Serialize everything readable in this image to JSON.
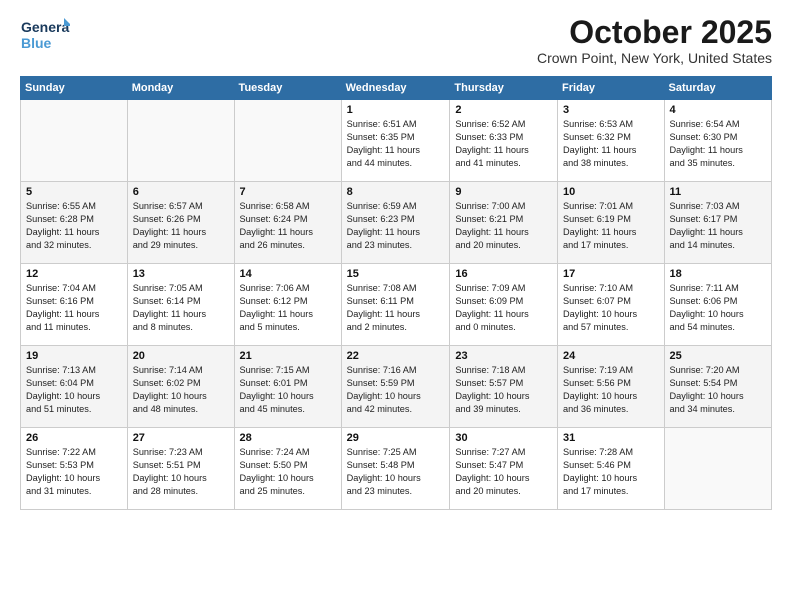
{
  "header": {
    "logo_line1": "General",
    "logo_line2": "Blue",
    "month_title": "October 2025",
    "location": "Crown Point, New York, United States"
  },
  "weekdays": [
    "Sunday",
    "Monday",
    "Tuesday",
    "Wednesday",
    "Thursday",
    "Friday",
    "Saturday"
  ],
  "weeks": [
    [
      {
        "day": "",
        "info": ""
      },
      {
        "day": "",
        "info": ""
      },
      {
        "day": "",
        "info": ""
      },
      {
        "day": "1",
        "info": "Sunrise: 6:51 AM\nSunset: 6:35 PM\nDaylight: 11 hours\nand 44 minutes."
      },
      {
        "day": "2",
        "info": "Sunrise: 6:52 AM\nSunset: 6:33 PM\nDaylight: 11 hours\nand 41 minutes."
      },
      {
        "day": "3",
        "info": "Sunrise: 6:53 AM\nSunset: 6:32 PM\nDaylight: 11 hours\nand 38 minutes."
      },
      {
        "day": "4",
        "info": "Sunrise: 6:54 AM\nSunset: 6:30 PM\nDaylight: 11 hours\nand 35 minutes."
      }
    ],
    [
      {
        "day": "5",
        "info": "Sunrise: 6:55 AM\nSunset: 6:28 PM\nDaylight: 11 hours\nand 32 minutes."
      },
      {
        "day": "6",
        "info": "Sunrise: 6:57 AM\nSunset: 6:26 PM\nDaylight: 11 hours\nand 29 minutes."
      },
      {
        "day": "7",
        "info": "Sunrise: 6:58 AM\nSunset: 6:24 PM\nDaylight: 11 hours\nand 26 minutes."
      },
      {
        "day": "8",
        "info": "Sunrise: 6:59 AM\nSunset: 6:23 PM\nDaylight: 11 hours\nand 23 minutes."
      },
      {
        "day": "9",
        "info": "Sunrise: 7:00 AM\nSunset: 6:21 PM\nDaylight: 11 hours\nand 20 minutes."
      },
      {
        "day": "10",
        "info": "Sunrise: 7:01 AM\nSunset: 6:19 PM\nDaylight: 11 hours\nand 17 minutes."
      },
      {
        "day": "11",
        "info": "Sunrise: 7:03 AM\nSunset: 6:17 PM\nDaylight: 11 hours\nand 14 minutes."
      }
    ],
    [
      {
        "day": "12",
        "info": "Sunrise: 7:04 AM\nSunset: 6:16 PM\nDaylight: 11 hours\nand 11 minutes."
      },
      {
        "day": "13",
        "info": "Sunrise: 7:05 AM\nSunset: 6:14 PM\nDaylight: 11 hours\nand 8 minutes."
      },
      {
        "day": "14",
        "info": "Sunrise: 7:06 AM\nSunset: 6:12 PM\nDaylight: 11 hours\nand 5 minutes."
      },
      {
        "day": "15",
        "info": "Sunrise: 7:08 AM\nSunset: 6:11 PM\nDaylight: 11 hours\nand 2 minutes."
      },
      {
        "day": "16",
        "info": "Sunrise: 7:09 AM\nSunset: 6:09 PM\nDaylight: 11 hours\nand 0 minutes."
      },
      {
        "day": "17",
        "info": "Sunrise: 7:10 AM\nSunset: 6:07 PM\nDaylight: 10 hours\nand 57 minutes."
      },
      {
        "day": "18",
        "info": "Sunrise: 7:11 AM\nSunset: 6:06 PM\nDaylight: 10 hours\nand 54 minutes."
      }
    ],
    [
      {
        "day": "19",
        "info": "Sunrise: 7:13 AM\nSunset: 6:04 PM\nDaylight: 10 hours\nand 51 minutes."
      },
      {
        "day": "20",
        "info": "Sunrise: 7:14 AM\nSunset: 6:02 PM\nDaylight: 10 hours\nand 48 minutes."
      },
      {
        "day": "21",
        "info": "Sunrise: 7:15 AM\nSunset: 6:01 PM\nDaylight: 10 hours\nand 45 minutes."
      },
      {
        "day": "22",
        "info": "Sunrise: 7:16 AM\nSunset: 5:59 PM\nDaylight: 10 hours\nand 42 minutes."
      },
      {
        "day": "23",
        "info": "Sunrise: 7:18 AM\nSunset: 5:57 PM\nDaylight: 10 hours\nand 39 minutes."
      },
      {
        "day": "24",
        "info": "Sunrise: 7:19 AM\nSunset: 5:56 PM\nDaylight: 10 hours\nand 36 minutes."
      },
      {
        "day": "25",
        "info": "Sunrise: 7:20 AM\nSunset: 5:54 PM\nDaylight: 10 hours\nand 34 minutes."
      }
    ],
    [
      {
        "day": "26",
        "info": "Sunrise: 7:22 AM\nSunset: 5:53 PM\nDaylight: 10 hours\nand 31 minutes."
      },
      {
        "day": "27",
        "info": "Sunrise: 7:23 AM\nSunset: 5:51 PM\nDaylight: 10 hours\nand 28 minutes."
      },
      {
        "day": "28",
        "info": "Sunrise: 7:24 AM\nSunset: 5:50 PM\nDaylight: 10 hours\nand 25 minutes."
      },
      {
        "day": "29",
        "info": "Sunrise: 7:25 AM\nSunset: 5:48 PM\nDaylight: 10 hours\nand 23 minutes."
      },
      {
        "day": "30",
        "info": "Sunrise: 7:27 AM\nSunset: 5:47 PM\nDaylight: 10 hours\nand 20 minutes."
      },
      {
        "day": "31",
        "info": "Sunrise: 7:28 AM\nSunset: 5:46 PM\nDaylight: 10 hours\nand 17 minutes."
      },
      {
        "day": "",
        "info": ""
      }
    ]
  ]
}
